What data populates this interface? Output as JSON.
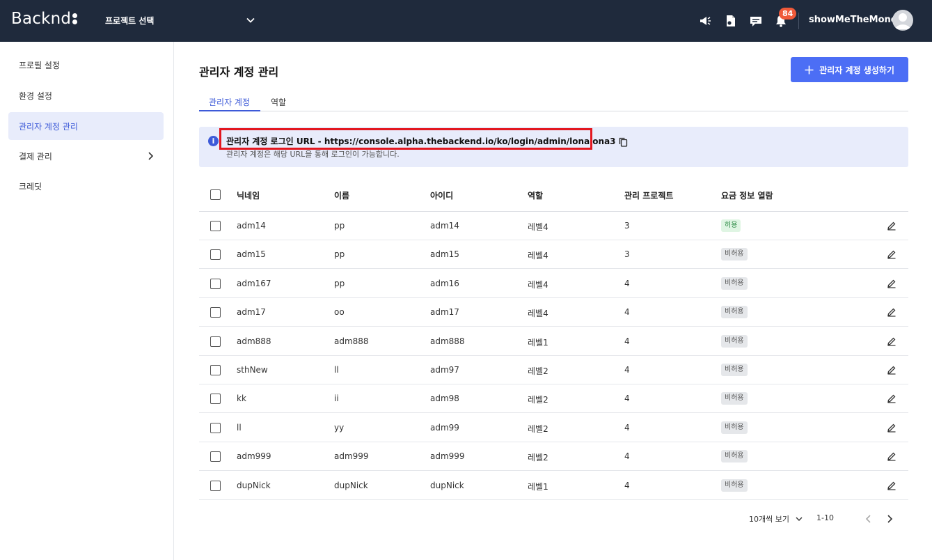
{
  "header": {
    "brand": "Backnd",
    "project_select": "프로젝트 선택",
    "notification_count": "84",
    "username": "showMeTheMoney",
    "icons": [
      "megaphone-icon",
      "document-icon",
      "chat-icon",
      "bell-icon",
      "chevron-down-icon",
      "avatar-icon"
    ]
  },
  "sidebar": {
    "items": [
      {
        "label": "프로필 설정"
      },
      {
        "label": "환경 설정"
      },
      {
        "label": "관리자 계정 관리"
      },
      {
        "label": "결제 관리"
      },
      {
        "label": "크레딧"
      }
    ]
  },
  "main": {
    "title": "관리자 계정 관리",
    "create_button": "관리자 계정 생성하기",
    "tabs": [
      {
        "label": "관리자 계정"
      },
      {
        "label": "역할"
      }
    ],
    "info": {
      "title": "관리자 계정 로그인 URL - https://console.alpha.thebackend.io/ko/login/admin/lonalona3",
      "subtitle": "관리자 계정은 해당 URL을 통해 로그인이 가능합니다."
    },
    "table": {
      "columns": [
        "닉네임",
        "이름",
        "아이디",
        "역할",
        "관리 프로젝트",
        "요금 정보 열람"
      ],
      "rows": [
        {
          "nickname": "adm14",
          "name": "pp",
          "id": "adm14",
          "role": "레벨4",
          "projects": "3",
          "billing": "허용"
        },
        {
          "nickname": "adm15",
          "name": "pp",
          "id": "adm15",
          "role": "레벨4",
          "projects": "3",
          "billing": "비허용"
        },
        {
          "nickname": "adm167",
          "name": "pp",
          "id": "adm16",
          "role": "레벨4",
          "projects": "4",
          "billing": "비허용"
        },
        {
          "nickname": "adm17",
          "name": "oo",
          "id": "adm17",
          "role": "레벨4",
          "projects": "4",
          "billing": "비허용"
        },
        {
          "nickname": "adm888",
          "name": "adm888",
          "id": "adm888",
          "role": "레벨1",
          "projects": "4",
          "billing": "비허용"
        },
        {
          "nickname": "sthNew",
          "name": "ll",
          "id": "adm97",
          "role": "레벨2",
          "projects": "4",
          "billing": "비허용"
        },
        {
          "nickname": "kk",
          "name": "ii",
          "id": "adm98",
          "role": "레벨2",
          "projects": "4",
          "billing": "비허용"
        },
        {
          "nickname": "ll",
          "name": "yy",
          "id": "adm99",
          "role": "레벨2",
          "projects": "4",
          "billing": "비허용"
        },
        {
          "nickname": "adm999",
          "name": "adm999",
          "id": "adm999",
          "role": "레벨2",
          "projects": "4",
          "billing": "비허용"
        },
        {
          "nickname": "dupNick",
          "name": "dupNick",
          "id": "dupNick",
          "role": "레벨1",
          "projects": "4",
          "billing": "비허용"
        }
      ]
    },
    "pagination": {
      "page_size": "10개씩 보기",
      "range": "1-10"
    }
  },
  "colors": {
    "topbar": "#1f2a3c",
    "accent": "#4c6ef5",
    "highlight_box": "#e3171f",
    "badge": "#f05a3a"
  }
}
